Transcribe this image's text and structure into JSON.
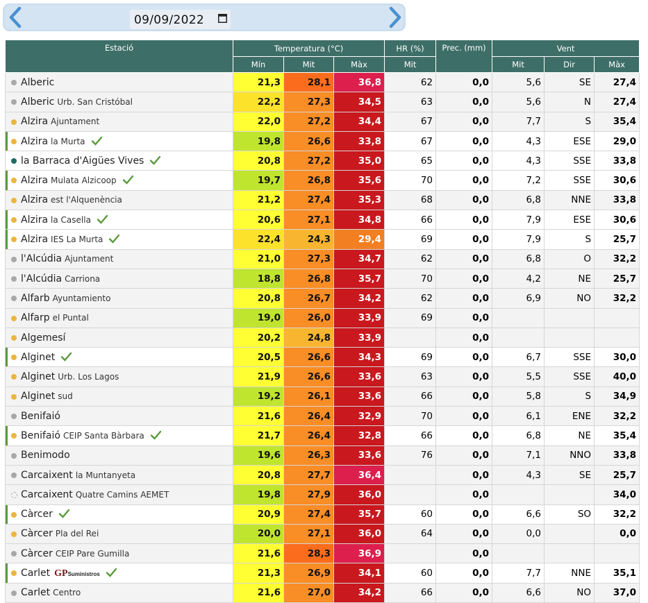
{
  "nav": {
    "date_value": "09/09/2022",
    "prev_icon": "chevron-left-icon",
    "next_icon": "chevron-right-icon"
  },
  "colors": {
    "header_bg": "#3e6e68",
    "check_green": "#5a9a3c"
  },
  "header": {
    "station": "Estació",
    "temperature": "Temperatura (°C)",
    "hr": "HR (%)",
    "prec": "Prec. (mm)",
    "wind": "Vent",
    "min": "Mín",
    "mit": "Mit",
    "max": "Màx",
    "hr_mit": "Mit",
    "wind_mit": "Mit",
    "wind_dir": "Dir",
    "wind_max": "Màx"
  },
  "rows": [
    {
      "name": "Alberic",
      "sub": "",
      "dot": "#a8a8a8",
      "bar": false,
      "check": false,
      "min": "21,3",
      "mit": "28,1",
      "max": "36,8",
      "hr": "62",
      "prec": "0,0",
      "wmit": "5,6",
      "dir": "SE",
      "wmax": "27,4",
      "cmin": "#ffff33",
      "cmit": "#fb6d1c",
      "cmax": "#dc1f4d"
    },
    {
      "name": "Alberic",
      "sub": "Urb. San Cristóbal",
      "dot": "#a8a8a8",
      "bar": false,
      "check": false,
      "min": "22,2",
      "mit": "27,3",
      "max": "34,5",
      "hr": "63",
      "prec": "0,0",
      "wmit": "5,6",
      "dir": "N",
      "wmax": "27,4",
      "cmin": "#fde22b",
      "cmit": "#f98d26",
      "cmax": "#c9181e"
    },
    {
      "name": "Alzira",
      "sub": "Ajuntament",
      "dot": "#ecb53d",
      "bar": false,
      "check": false,
      "min": "22,0",
      "mit": "27,2",
      "max": "34,4",
      "hr": "67",
      "prec": "0,0",
      "wmit": "7,7",
      "dir": "S",
      "wmax": "35,4",
      "cmin": "#ffff33",
      "cmit": "#f98d26",
      "cmax": "#c9181e"
    },
    {
      "name": "Alzira",
      "sub": "la Murta",
      "dot": "#ecb53d",
      "bar": true,
      "check": true,
      "min": "19,8",
      "mit": "26,6",
      "max": "33,8",
      "hr": "67",
      "prec": "0,0",
      "wmit": "4,3",
      "dir": "ESE",
      "wmax": "29,0",
      "cmin": "#bfe52f",
      "cmit": "#f98d26",
      "cmax": "#c9181e"
    },
    {
      "name": "la Barraca d'Aigües Vives",
      "sub": "",
      "dot": "#1f6b63",
      "bar": false,
      "check": true,
      "min": "20,8",
      "mit": "27,2",
      "max": "35,0",
      "hr": "65",
      "prec": "0,0",
      "wmit": "4,3",
      "dir": "SSE",
      "wmax": "33,8",
      "cmin": "#ffff33",
      "cmit": "#f98d26",
      "cmax": "#c9181e"
    },
    {
      "name": "Alzira",
      "sub": "Mulata Alzicoop",
      "dot": "#ecb53d",
      "bar": true,
      "check": true,
      "min": "19,7",
      "mit": "26,8",
      "max": "35,6",
      "hr": "70",
      "prec": "0,0",
      "wmit": "7,2",
      "dir": "SSE",
      "wmax": "30,6",
      "cmin": "#bfe52f",
      "cmit": "#f98d26",
      "cmax": "#c9181e"
    },
    {
      "name": "Alzira",
      "sub": "est l'Alquenència",
      "dot": "#ecb53d",
      "bar": false,
      "check": false,
      "min": "21,2",
      "mit": "27,4",
      "max": "35,3",
      "hr": "68",
      "prec": "0,0",
      "wmit": "6,8",
      "dir": "NNE",
      "wmax": "33,8",
      "cmin": "#ffff33",
      "cmit": "#f98d26",
      "cmax": "#c9181e"
    },
    {
      "name": "Alzira",
      "sub": "la Casella",
      "dot": "#ecb53d",
      "bar": true,
      "check": true,
      "min": "20,6",
      "mit": "27,1",
      "max": "34,8",
      "hr": "66",
      "prec": "0,0",
      "wmit": "7,9",
      "dir": "ESE",
      "wmax": "30,6",
      "cmin": "#ffff33",
      "cmit": "#f98d26",
      "cmax": "#c9181e"
    },
    {
      "name": "Alzira",
      "sub": "IES La Murta",
      "dot": "#ecb53d",
      "bar": true,
      "check": true,
      "min": "22,4",
      "mit": "24,3",
      "max": "29,4",
      "hr": "69",
      "prec": "0,0",
      "wmit": "7,9",
      "dir": "S",
      "wmax": "25,7",
      "cmin": "#fde22b",
      "cmit": "#f8b52f",
      "cmax": "#f27f22"
    },
    {
      "name": "l'Alcúdia",
      "sub": "Ajuntament",
      "dot": "#a8a8a8",
      "bar": false,
      "check": false,
      "min": "21,0",
      "mit": "27,3",
      "max": "34,7",
      "hr": "62",
      "prec": "0,0",
      "wmit": "6,8",
      "dir": "O",
      "wmax": "32,2",
      "cmin": "#ffff33",
      "cmit": "#f98d26",
      "cmax": "#c9181e"
    },
    {
      "name": "l'Alcúdia",
      "sub": "Carriona",
      "dot": "#a8a8a8",
      "bar": false,
      "check": false,
      "min": "18,8",
      "mit": "26,8",
      "max": "35,7",
      "hr": "70",
      "prec": "0,0",
      "wmit": "4,2",
      "dir": "NE",
      "wmax": "25,7",
      "cmin": "#bfe52f",
      "cmit": "#f98d26",
      "cmax": "#c9181e"
    },
    {
      "name": "Alfarb",
      "sub": "Ayuntamiento",
      "dot": "#a8a8a8",
      "bar": false,
      "check": false,
      "min": "20,8",
      "mit": "26,7",
      "max": "34,2",
      "hr": "62",
      "prec": "0,0",
      "wmit": "6,9",
      "dir": "NO",
      "wmax": "32,2",
      "cmin": "#ffff33",
      "cmit": "#f98d26",
      "cmax": "#c9181e"
    },
    {
      "name": "Alfarp",
      "sub": "el Puntal",
      "dot": "#ecb53d",
      "bar": false,
      "check": false,
      "min": "19,0",
      "mit": "26,0",
      "max": "33,9",
      "hr": "69",
      "prec": "0,0",
      "wmit": "",
      "dir": "",
      "wmax": "",
      "cmin": "#bfe52f",
      "cmit": "#f98d26",
      "cmax": "#c9181e"
    },
    {
      "name": "Algemesí",
      "sub": "",
      "dot": "#ecb53d",
      "bar": false,
      "check": false,
      "min": "20,2",
      "mit": "24,8",
      "max": "33,9",
      "hr": "",
      "prec": "0,0",
      "wmit": "",
      "dir": "",
      "wmax": "",
      "cmin": "#ffff33",
      "cmit": "#f8b52f",
      "cmax": "#c9181e"
    },
    {
      "name": "Alginet",
      "sub": "",
      "dot": "#ecb53d",
      "bar": true,
      "check": true,
      "min": "20,5",
      "mit": "26,6",
      "max": "34,3",
      "hr": "69",
      "prec": "0,0",
      "wmit": "6,7",
      "dir": "SSE",
      "wmax": "30,0",
      "cmin": "#ffff33",
      "cmit": "#f98d26",
      "cmax": "#c9181e"
    },
    {
      "name": "Alginet",
      "sub": "Urb. Los Lagos",
      "dot": "#ecb53d",
      "bar": false,
      "check": false,
      "min": "21,9",
      "mit": "26,6",
      "max": "33,6",
      "hr": "63",
      "prec": "0,0",
      "wmit": "5,5",
      "dir": "SSE",
      "wmax": "40,0",
      "cmin": "#ffff33",
      "cmit": "#f98d26",
      "cmax": "#c9181e"
    },
    {
      "name": "Alginet",
      "sub": "sud",
      "dot": "#ecb53d",
      "bar": false,
      "check": false,
      "min": "19,2",
      "mit": "26,1",
      "max": "33,6",
      "hr": "66",
      "prec": "0,0",
      "wmit": "5,8",
      "dir": "S",
      "wmax": "34,9",
      "cmin": "#bfe52f",
      "cmit": "#f98d26",
      "cmax": "#c9181e"
    },
    {
      "name": "Benifaió",
      "sub": "",
      "dot": "#a8a8a8",
      "bar": false,
      "check": false,
      "min": "21,6",
      "mit": "26,4",
      "max": "32,9",
      "hr": "70",
      "prec": "0,0",
      "wmit": "6,1",
      "dir": "ENE",
      "wmax": "32,2",
      "cmin": "#ffff33",
      "cmit": "#f98d26",
      "cmax": "#c9181e"
    },
    {
      "name": "Benifaió",
      "sub": "CEIP Santa Bàrbara",
      "dot": "#ecb53d",
      "bar": true,
      "check": true,
      "min": "21,7",
      "mit": "26,4",
      "max": "32,8",
      "hr": "66",
      "prec": "0,0",
      "wmit": "6,8",
      "dir": "NE",
      "wmax": "35,4",
      "cmin": "#ffff33",
      "cmit": "#f98d26",
      "cmax": "#c9181e"
    },
    {
      "name": "Benimodo",
      "sub": "",
      "dot": "#a8a8a8",
      "bar": false,
      "check": false,
      "min": "19,6",
      "mit": "26,3",
      "max": "33,6",
      "hr": "76",
      "prec": "0,0",
      "wmit": "7,1",
      "dir": "NNO",
      "wmax": "33,8",
      "cmin": "#bfe52f",
      "cmit": "#f98d26",
      "cmax": "#c9181e"
    },
    {
      "name": "Carcaixent",
      "sub": "la Muntanyeta",
      "dot": "#a8a8a8",
      "bar": false,
      "check": false,
      "min": "20,8",
      "mit": "27,7",
      "max": "36,4",
      "hr": "",
      "prec": "0,0",
      "wmit": "4,3",
      "dir": "SE",
      "wmax": "25,7",
      "cmin": "#ffff33",
      "cmit": "#f98d26",
      "cmax": "#dc1f4d"
    },
    {
      "name": "Carcaixent",
      "sub": "Quatre Camins AEMET",
      "dot": "hollow",
      "bar": false,
      "check": false,
      "min": "19,8",
      "mit": "27,9",
      "max": "36,0",
      "hr": "",
      "prec": "0,0",
      "wmit": "",
      "dir": "",
      "wmax": "34,0",
      "cmin": "#bfe52f",
      "cmit": "#f98d26",
      "cmax": "#c9181e"
    },
    {
      "name": "Càrcer",
      "sub": "",
      "dot": "#ecb53d",
      "bar": true,
      "check": true,
      "min": "20,9",
      "mit": "27,4",
      "max": "35,7",
      "hr": "60",
      "prec": "0,0",
      "wmit": "6,6",
      "dir": "SO",
      "wmax": "32,2",
      "cmin": "#ffff33",
      "cmit": "#f98d26",
      "cmax": "#c9181e"
    },
    {
      "name": "Càrcer",
      "sub": "Pla del Rei",
      "dot": "#ecb53d",
      "bar": false,
      "check": false,
      "min": "20,0",
      "mit": "27,1",
      "max": "36,0",
      "hr": "64",
      "prec": "0,0",
      "wmit": "0,0",
      "dir": "",
      "wmax": "0,0",
      "cmin": "#bfe52f",
      "cmit": "#f98d26",
      "cmax": "#c9181e"
    },
    {
      "name": "Càrcer",
      "sub": "CEIP Pare Gumilla",
      "dot": "#a8a8a8",
      "bar": false,
      "check": false,
      "min": "21,6",
      "mit": "28,3",
      "max": "36,9",
      "hr": "",
      "prec": "0,0",
      "wmit": "",
      "dir": "",
      "wmax": "",
      "cmin": "#ffff33",
      "cmit": "#fb6d1c",
      "cmax": "#dc1f4d"
    },
    {
      "name": "Carlet",
      "sub": "",
      "logo": "GP",
      "logo_small": "Suministros",
      "dot": "#ecb53d",
      "bar": true,
      "check": true,
      "min": "21,3",
      "mit": "26,9",
      "max": "34,1",
      "hr": "60",
      "prec": "0,0",
      "wmit": "7,7",
      "dir": "NNE",
      "wmax": "35,1",
      "cmin": "#ffff33",
      "cmit": "#f98d26",
      "cmax": "#c9181e"
    },
    {
      "name": "Carlet",
      "sub": "Centro",
      "dot": "#a8a8a8",
      "bar": false,
      "check": false,
      "min": "21,6",
      "mit": "27,0",
      "max": "34,2",
      "hr": "66",
      "prec": "0,0",
      "wmit": "6,6",
      "dir": "NO",
      "wmax": "37,0",
      "cmin": "#ffff33",
      "cmit": "#f98d26",
      "cmax": "#c9181e"
    }
  ]
}
